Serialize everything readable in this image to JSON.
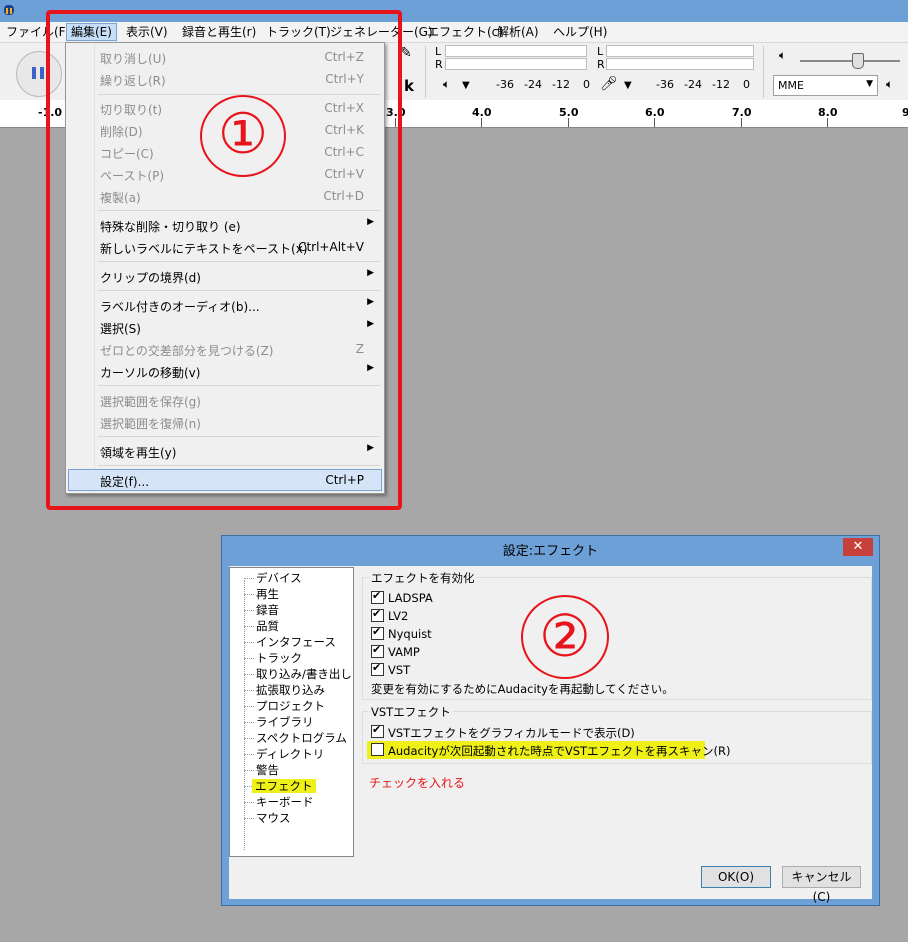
{
  "menubar": {
    "items": [
      "ファイル(F)",
      "編集(E)",
      "表示(V)",
      "録音と再生(r)",
      "トラック(T)",
      "ジェネレーター(G)",
      "エフェクト(c)",
      "解析(A)",
      "ヘルプ(H)"
    ]
  },
  "toolbar": {
    "meter_lr": [
      "L",
      "R"
    ],
    "meter_scale": [
      "-36",
      "-24",
      "-12",
      "0"
    ],
    "host_value": "MME"
  },
  "ruler": {
    "ticks": [
      "-1.0",
      "3.0",
      "4.0",
      "5.0",
      "6.0",
      "7.0",
      "8.0",
      "9"
    ]
  },
  "edit_menu": {
    "items": [
      {
        "label": "取り消し(U)",
        "shortcut": "Ctrl+Z",
        "enabled": false
      },
      {
        "label": "繰り返し(R)",
        "shortcut": "Ctrl+Y",
        "enabled": false
      },
      {
        "label": "切り取り(t)",
        "shortcut": "Ctrl+X",
        "enabled": false
      },
      {
        "label": "削除(D)",
        "shortcut": "Ctrl+K",
        "enabled": false
      },
      {
        "label": "コピー(C)",
        "shortcut": "Ctrl+C",
        "enabled": false
      },
      {
        "label": "ペースト(P)",
        "shortcut": "Ctrl+V",
        "enabled": false
      },
      {
        "label": "複製(a)",
        "shortcut": "Ctrl+D",
        "enabled": false
      },
      {
        "label": "特殊な削除・切り取り (e)",
        "shortcut": "",
        "enabled": true
      },
      {
        "label": "新しいラベルにテキストをペースト(x)",
        "shortcut": "Ctrl+Alt+V",
        "enabled": true
      },
      {
        "label": "クリップの境界(d)",
        "shortcut": "",
        "enabled": true
      },
      {
        "label": "ラベル付きのオーディオ(b)...",
        "shortcut": "",
        "enabled": true
      },
      {
        "label": "選択(S)",
        "shortcut": "",
        "enabled": true
      },
      {
        "label": "ゼロとの交差部分を見つける(Z)",
        "shortcut": "Z",
        "enabled": false
      },
      {
        "label": "カーソルの移動(v)",
        "shortcut": "",
        "enabled": true
      },
      {
        "label": "選択範囲を保存(g)",
        "shortcut": "",
        "enabled": false
      },
      {
        "label": "選択範囲を復帰(n)",
        "shortcut": "",
        "enabled": false
      },
      {
        "label": "領域を再生(y)",
        "shortcut": "",
        "enabled": true
      },
      {
        "label": "設定(f)...",
        "shortcut": "Ctrl+P",
        "enabled": true
      }
    ]
  },
  "annotations": {
    "step1": "①",
    "step2": "②",
    "note": "チェックを入れる",
    "note_color": "#e8141b"
  },
  "dialog": {
    "title": "設定:エフェクト",
    "close": "✕",
    "tree": [
      "デバイス",
      "再生",
      "録音",
      "品質",
      "インタフェース",
      "トラック",
      "取り込み/書き出し",
      "拡張取り込み",
      "プロジェクト",
      "ライブラリ",
      "スペクトログラム",
      "ディレクトリ",
      "警告",
      "エフェクト",
      "キーボード",
      "マウス"
    ],
    "enable_group": {
      "title": "エフェクトを有効化",
      "items": [
        {
          "label": "LADSPA",
          "checked": true
        },
        {
          "label": "LV2",
          "checked": true
        },
        {
          "label": "Nyquist",
          "checked": true
        },
        {
          "label": "VAMP",
          "checked": true
        },
        {
          "label": "VST",
          "checked": true
        }
      ],
      "restart_note": "変更を有効にするためにAudacityを再起動してください。"
    },
    "vst_group": {
      "title": "VSTエフェクト",
      "graphical": {
        "label": "VSTエフェクトをグラフィカルモードで表示(D)",
        "checked": true
      },
      "rescan": {
        "label": "Audacityが次回起動された時点でVSTエフェクトを再スキャン(R)",
        "checked": false
      }
    },
    "ok": "OK(O)",
    "cancel": "キャンセル(C)"
  }
}
